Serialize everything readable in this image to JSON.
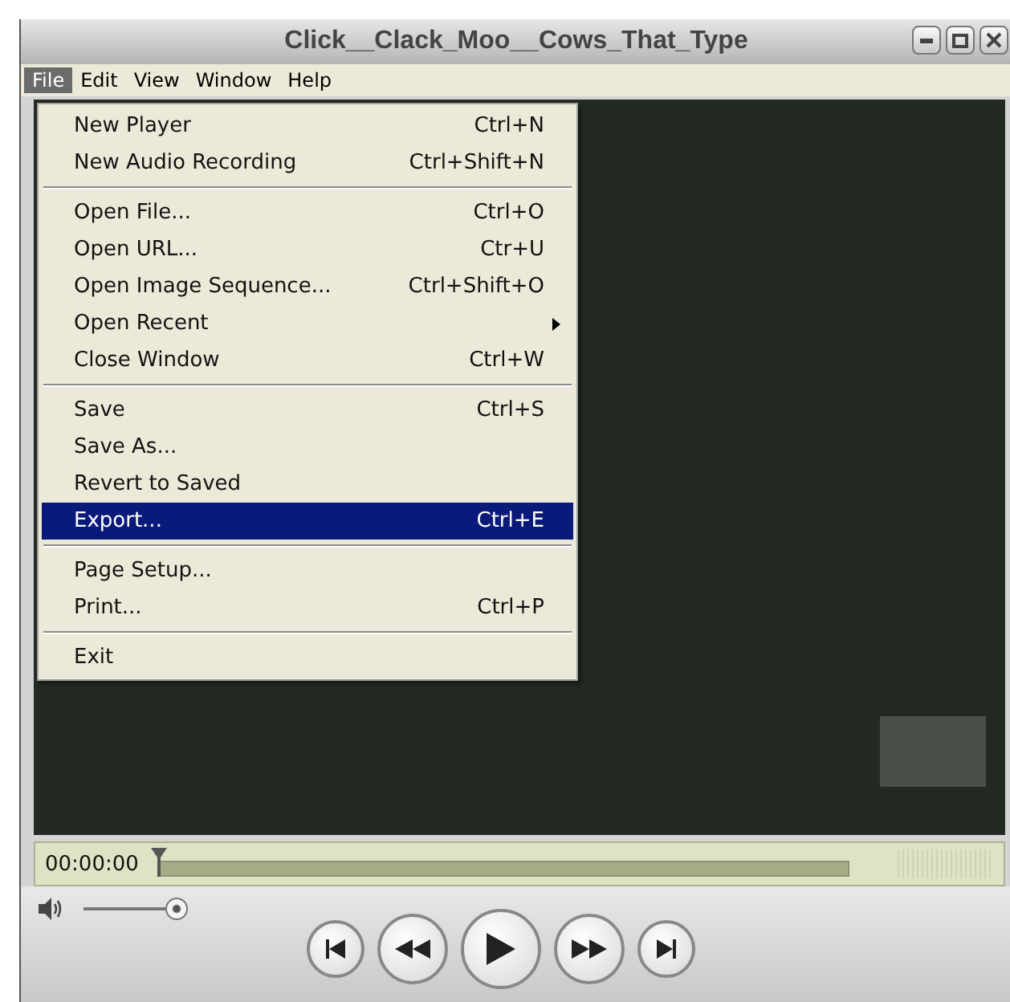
{
  "window": {
    "title": "Click__Clack_Moo__Cows_That_Type"
  },
  "menu_bar": [
    {
      "label": "File",
      "selected": true
    },
    {
      "label": "Edit",
      "selected": false
    },
    {
      "label": "View",
      "selected": false
    },
    {
      "label": "Window",
      "selected": false
    },
    {
      "label": "Help",
      "selected": false
    }
  ],
  "file_menu": [
    {
      "kind": "item",
      "label": "New Player",
      "shortcut": "Ctrl+N",
      "selected": false
    },
    {
      "kind": "item",
      "label": "New Audio Recording",
      "shortcut": "Ctrl+Shift+N",
      "selected": false
    },
    {
      "kind": "separator"
    },
    {
      "kind": "item",
      "label": "Open File...",
      "shortcut": "Ctrl+O",
      "selected": false
    },
    {
      "kind": "item",
      "label": "Open URL...",
      "shortcut": "Ctr+U",
      "selected": false
    },
    {
      "kind": "item",
      "label": "Open Image Sequence...",
      "shortcut": "Ctrl+Shift+O",
      "selected": false
    },
    {
      "kind": "submenu",
      "label": "Open Recent",
      "selected": false
    },
    {
      "kind": "item",
      "label": "Close Window",
      "shortcut": "Ctrl+W",
      "selected": false
    },
    {
      "kind": "separator"
    },
    {
      "kind": "item",
      "label": "Save",
      "shortcut": "Ctrl+S",
      "selected": false
    },
    {
      "kind": "item",
      "label": "Save As...",
      "selected": false
    },
    {
      "kind": "item",
      "label": "Revert to Saved",
      "selected": false
    },
    {
      "kind": "item",
      "label": "Export...",
      "shortcut": "Ctrl+E",
      "selected": true
    },
    {
      "kind": "separator"
    },
    {
      "kind": "item",
      "label": "Page Setup...",
      "selected": false
    },
    {
      "kind": "item",
      "label": "Print...",
      "shortcut": "Ctrl+P",
      "selected": false
    },
    {
      "kind": "separator"
    },
    {
      "kind": "item",
      "label": "Exit",
      "selected": false
    }
  ],
  "timeline": {
    "time": "00:00:00",
    "level": 0
  },
  "volume": {
    "level": 1
  }
}
